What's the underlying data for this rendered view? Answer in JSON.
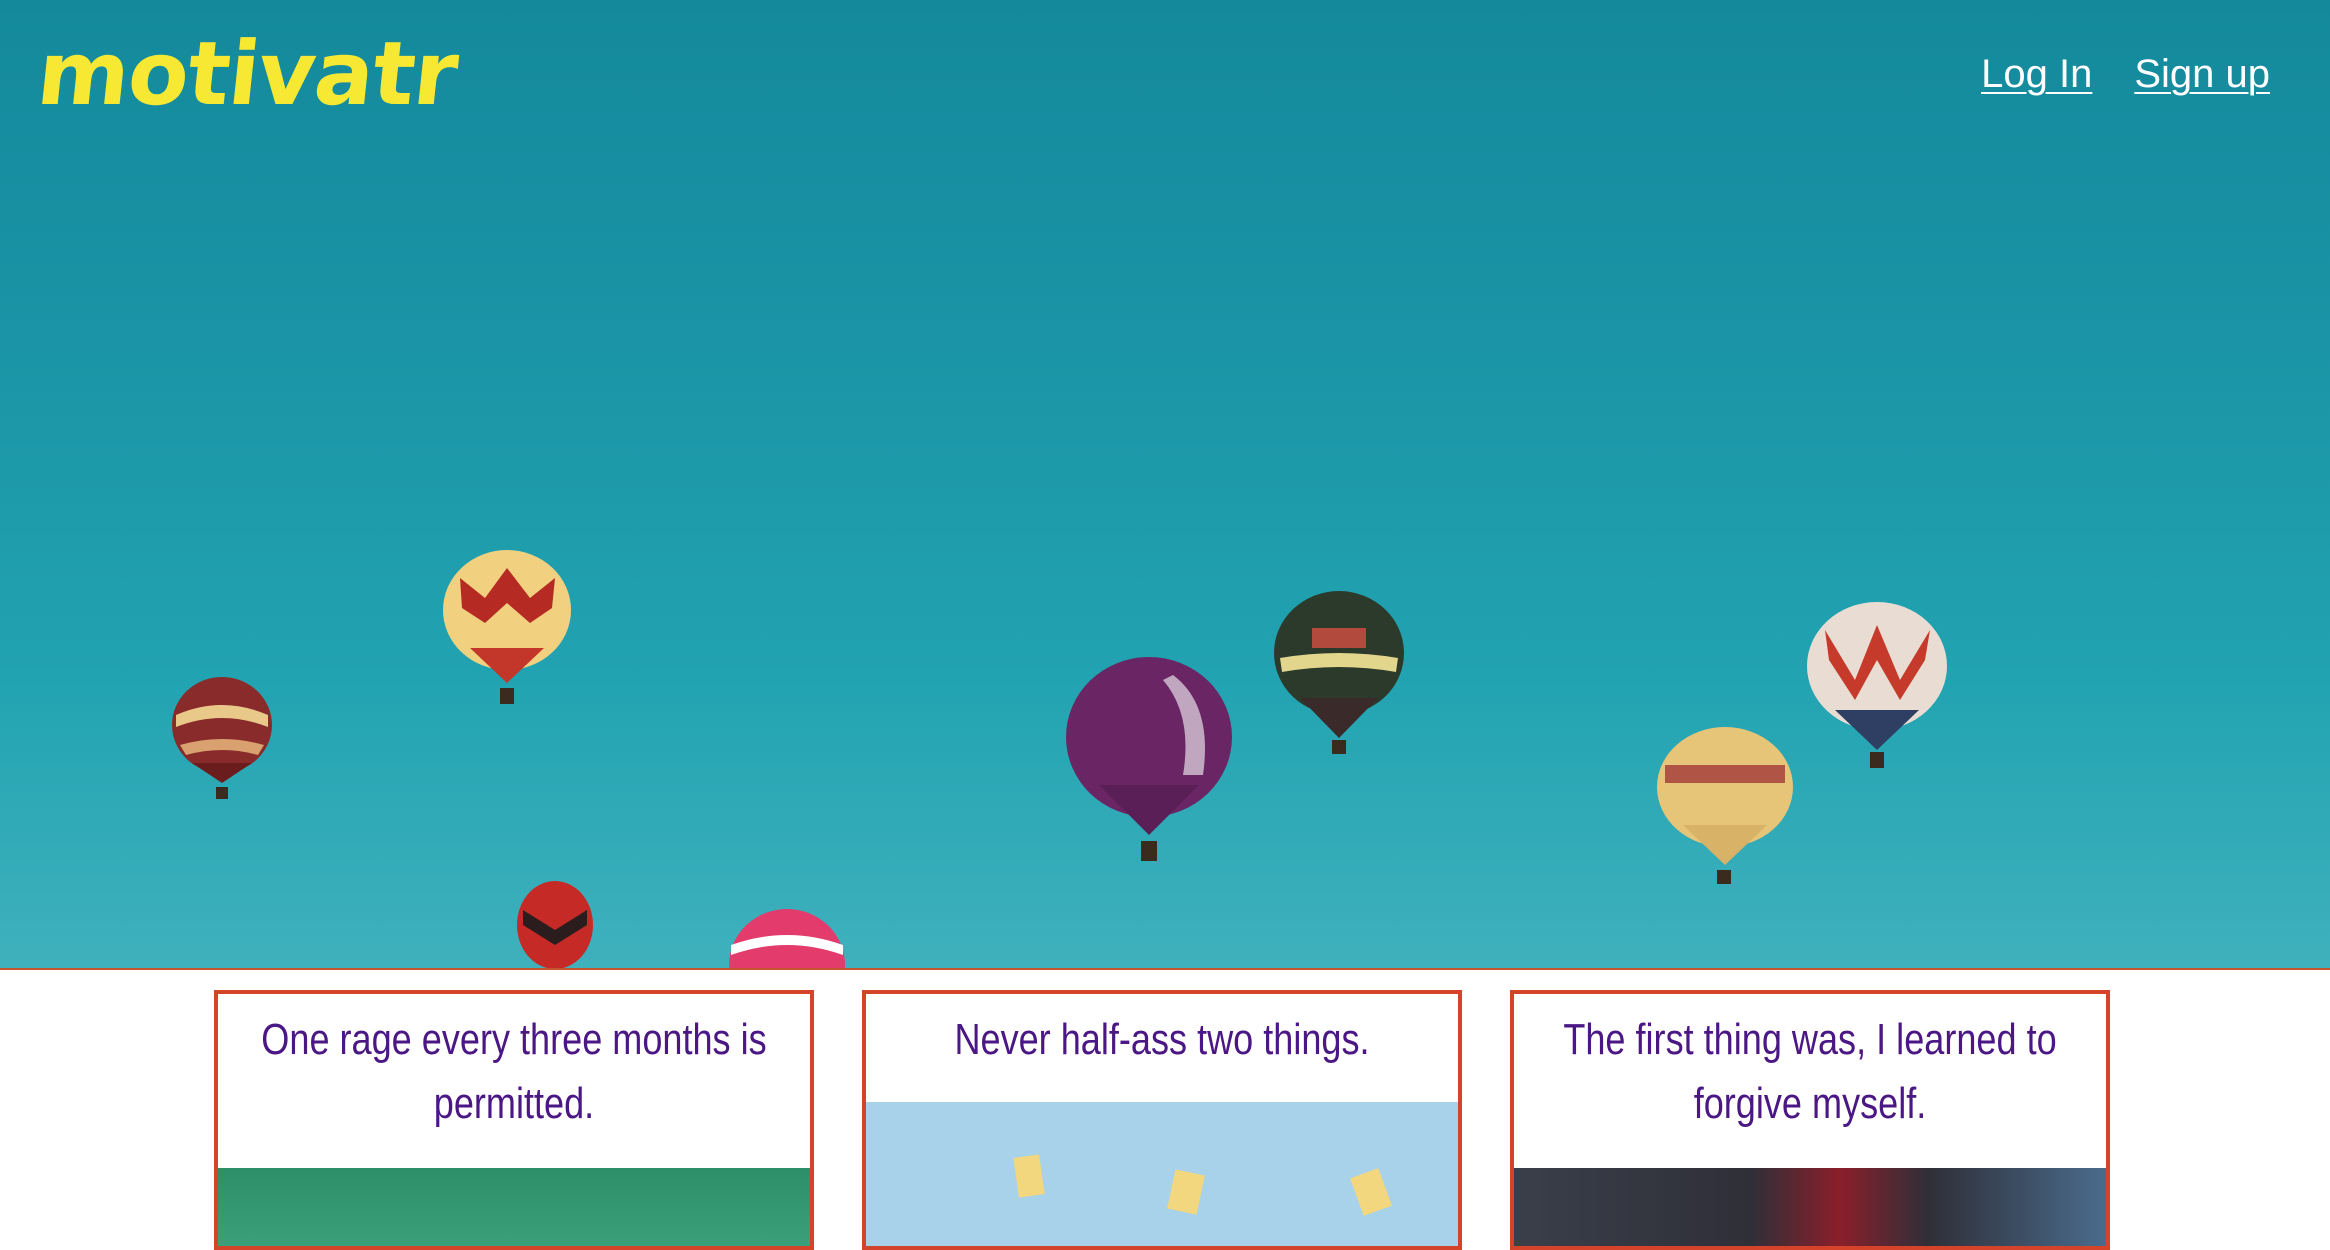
{
  "header": {
    "logo": "motivatr",
    "nav": {
      "login_label": "Log In",
      "signup_label": "Sign up"
    }
  },
  "hero": {
    "image": "hot-air-balloons-sky"
  },
  "cards": [
    {
      "quote": "One rage every three months is permitted.",
      "image": "green-field-photo"
    },
    {
      "quote": "Never half-ass two things.",
      "image": "light-blue-photo-with-yellow-objects"
    },
    {
      "quote": "The first thing was, I learned to forgive myself.",
      "image": "person-in-graphic-tee-photo"
    }
  ],
  "colors": {
    "logo": "#f7e833",
    "nav_link": "#ffffff",
    "hero_sky": "#1a94a6",
    "card_border": "#d5442a",
    "quote_text": "#4b1785"
  }
}
